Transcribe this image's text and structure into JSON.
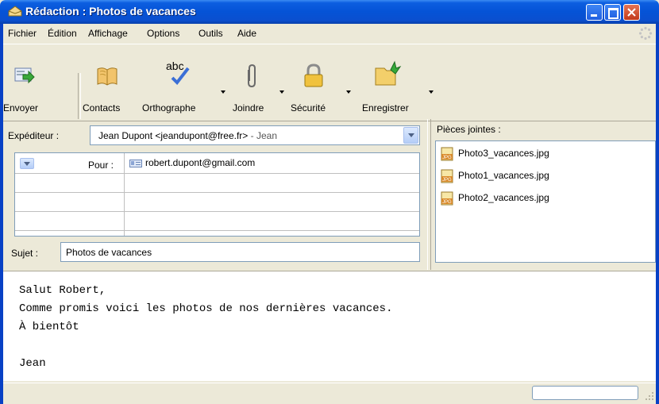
{
  "window": {
    "title": "Rédaction : Photos de vacances"
  },
  "menu": {
    "fichier": "Fichier",
    "edition": "Édition",
    "affichage": "Affichage",
    "options": "Options",
    "outils": "Outils",
    "aide": "Aide"
  },
  "toolbar": {
    "envoyer": "Envoyer",
    "contacts": "Contacts",
    "orthographe": "Orthographe",
    "joindre": "Joindre",
    "securite": "Sécurité",
    "enregistrer": "Enregistrer"
  },
  "header": {
    "from_label": "Expéditeur :",
    "from_value": "Jean Dupont <jeandupont@free.fr>",
    "from_suffix": " - Jean",
    "recipient_type": "Pour :",
    "recipient": "robert.dupont@gmail.com",
    "subject_label": "Sujet :",
    "subject_value": "Photos de vacances"
  },
  "attachments": {
    "title": "Pièces jointes :",
    "files": [
      "Photo3_vacances.jpg",
      "Photo1_vacances.jpg",
      "Photo2_vacances.jpg"
    ]
  },
  "body": {
    "lines": [
      "Salut Robert,",
      "Comme promis voici les photos de nos dernières vacances.",
      "À bientôt",
      "",
      "Jean"
    ]
  },
  "colors": {
    "titlebar": "#0553d6",
    "chrome": "#ece9d8",
    "field_border": "#7f9db9"
  }
}
